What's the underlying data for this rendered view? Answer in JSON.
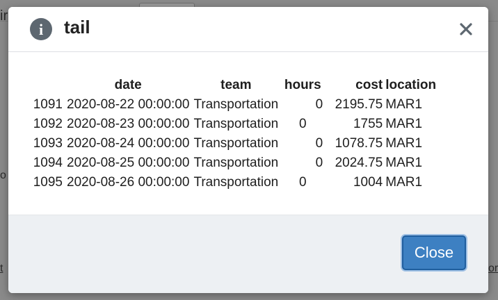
{
  "background": {
    "fragment_top_left": "ir",
    "fragment_mid_left": "o",
    "fragment_bottom_left": "t",
    "fragment_bottom_right": "or"
  },
  "dialog": {
    "icon": "info-icon",
    "title": "tail",
    "close_icon": "close-icon",
    "close_button_label": "Close",
    "accent_color": "#3d80c2"
  },
  "table": {
    "columns": [
      "",
      "date",
      "team",
      "hours",
      "cost",
      "location"
    ],
    "rows": [
      {
        "index": "1091",
        "date": "2020-08-22 00:00:00",
        "team": "Transportation",
        "hours": "0",
        "cost": "2195.75",
        "location": "MAR1"
      },
      {
        "index": "1092",
        "date": "2020-08-23 00:00:00",
        "team": "Transportation",
        "hours": "0",
        "cost": "1755",
        "location": "MAR1"
      },
      {
        "index": "1093",
        "date": "2020-08-24 00:00:00",
        "team": "Transportation",
        "hours": "0",
        "cost": "1078.75",
        "location": "MAR1"
      },
      {
        "index": "1094",
        "date": "2020-08-25 00:00:00",
        "team": "Transportation",
        "hours": "0",
        "cost": "2024.75",
        "location": "MAR1"
      },
      {
        "index": "1095",
        "date": "2020-08-26 00:00:00",
        "team": "Transportation",
        "hours": "0",
        "cost": "1004",
        "location": "MAR1"
      }
    ]
  }
}
